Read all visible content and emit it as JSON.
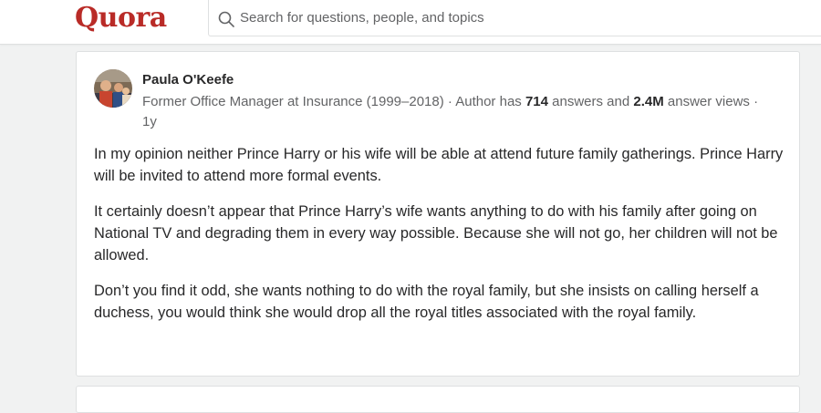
{
  "header": {
    "logo": "Quora",
    "search_placeholder": "Search for questions, people, and topics"
  },
  "answer": {
    "author_name": "Paula O'Keefe",
    "credential_prefix": "Former Office Manager at Insurance (1999–2018) · Author has ",
    "answers_count": "714",
    "credential_mid": " answers and ",
    "views_count": "2.4M",
    "credential_suffix": " answer views · 1y",
    "paragraphs": [
      "In my opinion neither Prince Harry or his wife will be able at attend future family gatherings. Prince Harry will be invited to attend more formal events.",
      "It certainly doesn’t appear that Prince Harry’s wife wants anything to do with his family after going on National TV and degrading them in every way possible. Because she will not go, her children will not be allowed.",
      "Don’t you find it odd, she wants nothing to do with the royal family, but she insists on calling herself a duchess, you would think she would drop all the royal titles associated with the royal family."
    ]
  },
  "colors": {
    "brand": "#b92b27",
    "text": "#282829",
    "muted": "#636466",
    "background": "#f1f2f2"
  }
}
